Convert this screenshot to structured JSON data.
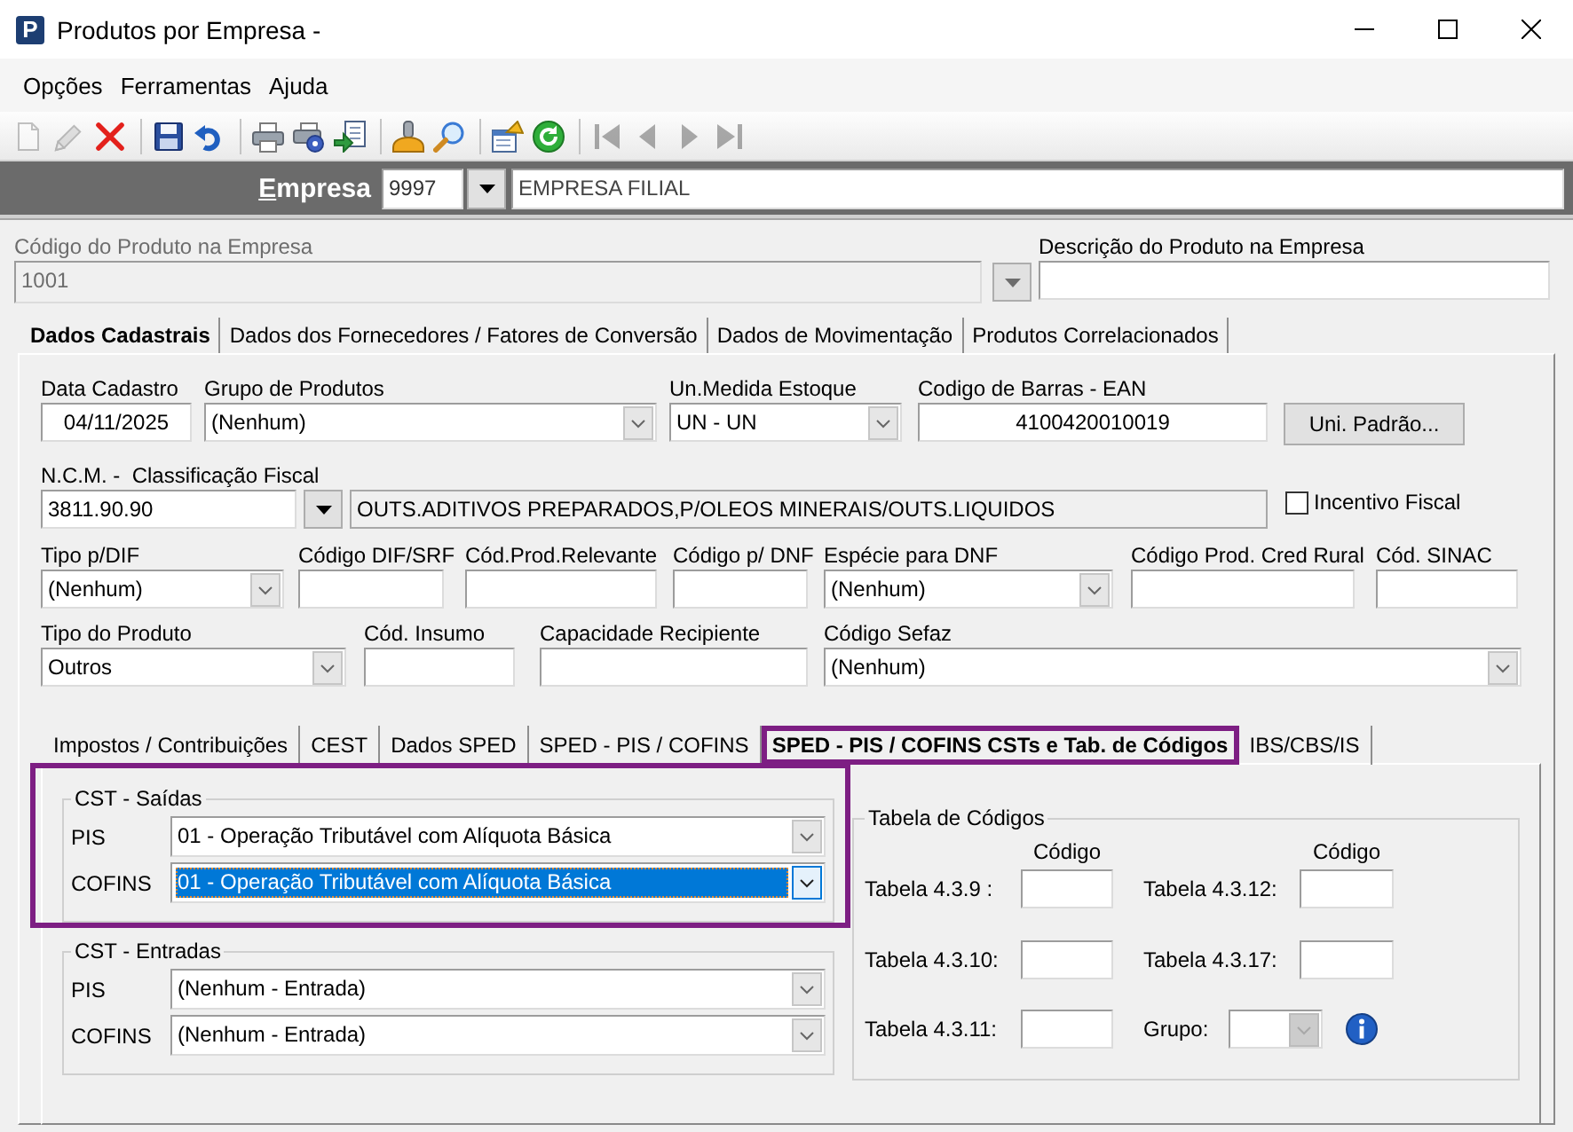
{
  "window": {
    "logo": "P",
    "title": "Produtos por Empresa -"
  },
  "menu": [
    {
      "label": "Opções"
    },
    {
      "label": "Ferramentas"
    },
    {
      "label": "Ajuda"
    }
  ],
  "toolbar": [
    [
      {
        "kind": "new",
        "disabled": true
      },
      {
        "kind": "edit",
        "disabled": true
      },
      {
        "kind": "delete",
        "disabled": false
      }
    ],
    [
      {
        "kind": "save",
        "disabled": false
      },
      {
        "kind": "undo",
        "disabled": false
      }
    ],
    [
      {
        "kind": "print",
        "disabled": false
      },
      {
        "kind": "print_setup",
        "disabled": false
      },
      {
        "kind": "export",
        "disabled": false
      }
    ],
    [
      {
        "kind": "stamp",
        "disabled": false
      },
      {
        "kind": "search",
        "disabled": false
      }
    ],
    [
      {
        "kind": "properties",
        "disabled": false
      },
      {
        "kind": "refresh",
        "disabled": false
      }
    ],
    [
      {
        "kind": "first",
        "disabled": true
      },
      {
        "kind": "previous",
        "disabled": true
      },
      {
        "kind": "next",
        "disabled": true
      },
      {
        "kind": "last",
        "disabled": true
      }
    ]
  ],
  "empresa": {
    "label": "Empresa",
    "code": "9997",
    "name": "EMPRESA FILIAL"
  },
  "product": {
    "code": {
      "label": "Código do Produto na Empresa",
      "value": "1001",
      "disabled": true
    },
    "description": {
      "label": "Descrição do Produto na Empresa"
    }
  },
  "tabs": [
    {
      "label": "Dados Cadastrais",
      "selected": true
    },
    {
      "label": "Dados dos Fornecedores / Fatores de Conversão",
      "selected": false
    },
    {
      "label": "Dados de Movimentação",
      "selected": false
    },
    {
      "label": "Produtos Correlacionados",
      "selected": false
    }
  ],
  "form": {
    "rows": [
      {
        "fields": [
          {
            "kind": "text",
            "label": "Data Cadastro",
            "value": "04/11/2025"
          },
          {
            "kind": "combo",
            "label": "Grupo de Produtos",
            "value": "(Nenhum)"
          },
          {
            "kind": "combo",
            "label": "Un.Medida Estoque",
            "value": "UN - UN"
          },
          {
            "kind": "text",
            "label": "Codigo de Barras - EAN",
            "value": "4100420010019"
          },
          {
            "kind": "button",
            "label": "Uni. Padrão..."
          }
        ]
      },
      {
        "fields": [
          {
            "kind": "lookup",
            "label": "N.C.M. -  Classificação Fiscal",
            "value": "3811.90.90"
          },
          {
            "kind": "display",
            "value": "OUTS.ADITIVOS PREPARADOS,P/OLEOS MINERAIS/OUTS.LIQUIDOS"
          },
          {
            "kind": "checkbox",
            "label": "Incentivo Fiscal",
            "checked": false
          }
        ]
      },
      {
        "fields": [
          {
            "kind": "combo",
            "label": "Tipo p/DIF",
            "value": "(Nenhum)"
          },
          {
            "kind": "text",
            "label": "Código DIF/SRF"
          },
          {
            "kind": "text",
            "label": "Cód.Prod.Relevante"
          },
          {
            "kind": "text",
            "label": "Código p/ DNF"
          },
          {
            "kind": "combo",
            "label": "Espécie para DNF",
            "value": "(Nenhum)"
          },
          {
            "kind": "text",
            "label": "Código Prod. Cred Rural"
          },
          {
            "kind": "text",
            "label": "Cód. SINAC"
          }
        ]
      },
      {
        "fields": [
          {
            "kind": "combo",
            "label": "Tipo do Produto",
            "value": "Outros"
          },
          {
            "kind": "text",
            "label": "Cód. Insumo"
          },
          {
            "kind": "text",
            "label": "Capacidade Recipiente"
          },
          {
            "kind": "combo",
            "label": "Código Sefaz",
            "value": "(Nenhum)"
          }
        ]
      }
    ]
  },
  "subtabs": [
    {
      "label": "Impostos / Contribuições",
      "selected": false,
      "highlighted": false
    },
    {
      "label": "CEST",
      "selected": false,
      "highlighted": false
    },
    {
      "label": "Dados SPED",
      "selected": false,
      "highlighted": false
    },
    {
      "label": "SPED - PIS / COFINS",
      "selected": false,
      "highlighted": false
    },
    {
      "label": "SPED - PIS / COFINS CSTs e Tab. de Códigos",
      "selected": true,
      "highlighted": true
    },
    {
      "label": "IBS/CBS/IS",
      "selected": false,
      "highlighted": false
    }
  ],
  "cst_groups": [
    {
      "title": "CST - Saídas",
      "highlighted": true,
      "rows": [
        {
          "label": "PIS",
          "value": "01 - Operação Tributável com Alíquota Básica",
          "focused": false
        },
        {
          "label": "COFINS",
          "value": "01 - Operação Tributável com Alíquota Básica",
          "focused": true
        }
      ]
    },
    {
      "title": "CST - Entradas",
      "highlighted": false,
      "rows": [
        {
          "label": "PIS",
          "value": "(Nenhum - Entrada)",
          "focused": false
        },
        {
          "label": "COFINS",
          "value": "(Nenhum - Entrada)",
          "focused": false
        }
      ]
    }
  ],
  "codes_table": {
    "title": "Tabela de Códigos",
    "column_headers": [
      "Código",
      "Código"
    ],
    "fields": [
      {
        "kind": "text",
        "label": "Tabela 4.3.9 :",
        "disabled": false
      },
      {
        "kind": "text",
        "label": "Tabela 4.3.12:",
        "disabled": false
      },
      {
        "kind": "text",
        "label": "Tabela 4.3.10:",
        "disabled": false
      },
      {
        "kind": "text",
        "label": "Tabela 4.3.17:",
        "disabled": false
      },
      {
        "kind": "text",
        "label": "Tabela 4.3.11:",
        "disabled": false
      },
      {
        "kind": "combo",
        "label": "Grupo:",
        "disabled": true
      }
    ]
  }
}
